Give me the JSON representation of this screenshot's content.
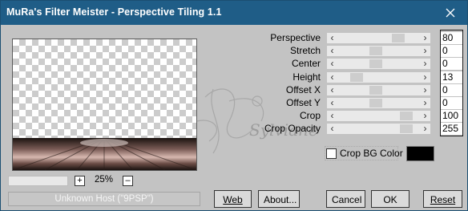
{
  "window": {
    "title": "MuRa's Filter Meister - Perspective Tiling 1.1"
  },
  "params": [
    {
      "label": "Perspective",
      "value": "80",
      "thumb": 0.78
    },
    {
      "label": "Stretch",
      "value": "0",
      "thumb": 0.46
    },
    {
      "label": "Center",
      "value": "0",
      "thumb": 0.46
    },
    {
      "label": "Height",
      "value": "13",
      "thumb": 0.18
    },
    {
      "label": "Offset X",
      "value": "0",
      "thumb": 0.46
    },
    {
      "label": "Offset Y",
      "value": "0",
      "thumb": 0.46
    },
    {
      "label": "Crop",
      "value": "100",
      "thumb": 0.9
    },
    {
      "label": "Crop Opacity",
      "value": "255",
      "thumb": 0.9
    }
  ],
  "zoom": {
    "value": "25%",
    "plus": "+",
    "minus": "–"
  },
  "status": "Unknown Host (\"9PSP\")",
  "crop_bg": {
    "label": "Crop BG Color",
    "checked": false,
    "color": "#000000"
  },
  "buttons": {
    "web": "Web",
    "about": "About...",
    "cancel": "Cancel",
    "ok": "OK",
    "reset": "Reset"
  },
  "watermark": "Sylviane",
  "colors": {
    "titlebar": "#1f5d87",
    "dialog": "#c3c3c3"
  }
}
